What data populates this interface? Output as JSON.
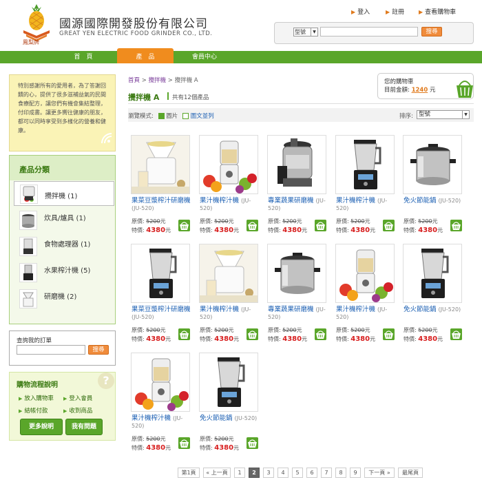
{
  "header": {
    "company_name": "國源國際開發股份有限公司",
    "company_name_en": "GREAT YEN ELECTRIC FOOD GRINDER CO., LTD.",
    "logo_text": "鳳梨牌",
    "links": [
      "登入",
      "註冊",
      "查看購物車"
    ]
  },
  "search": {
    "type_value": "型號",
    "button": "搜尋"
  },
  "nav": [
    "首　頁",
    "產　品",
    "會員中心"
  ],
  "intro": "特別感謝所有的愛用者，為了答謝回饋的心，提供了很多滋補益氣的民間食療配方，讓您們有機會集結整理，付印成書。讓更多嚮往健康的朋友，都可以同時享受到多樣化的營養和健康。",
  "categories": {
    "title": "產品分類",
    "items": [
      "攪拌機 (1)",
      "炊具/爐具 (1)",
      "食物處理器 (1)",
      "水果榨汁機 (5)",
      "研磨機 (2)"
    ]
  },
  "order_query": {
    "title": "查詢我的訂單",
    "button": "搜尋"
  },
  "flow": {
    "title": "購物流程說明",
    "links": [
      "放入購物車",
      "登入會員",
      "結帳付款",
      "收到商品"
    ],
    "buttons": [
      "更多說明",
      "我有問題"
    ]
  },
  "breadcrumb": {
    "home": "首頁",
    "sep1": ">",
    "cat": "攪拌機",
    "sep2": ">",
    "current": "攪拌機 A"
  },
  "cart": {
    "title": "您的購物車",
    "amount_label": "目前金額:",
    "amount": "1240",
    "unit": "元"
  },
  "main": {
    "category_title": "攪拌機 A",
    "count": "共有12個產品"
  },
  "view": {
    "label": "瀏覽模式:",
    "mode1": "圖片",
    "mode2": "圖文並列",
    "sort_label": "排序:",
    "sort_value": "型號"
  },
  "price_labels": {
    "orig": "原價:",
    "sale": "特價:",
    "unit": "元"
  },
  "products": [
    {
      "name": "果菜豆漿榨汁研磨機",
      "code": "(JU-520)",
      "orig": "5200",
      "price": "4380",
      "img": "grinder"
    },
    {
      "name": "果汁機榨汁機",
      "code": "(JU-520)",
      "orig": "5200",
      "price": "4380",
      "img": "blender-fruit"
    },
    {
      "name": "專業蔬果研磨機",
      "code": "(JU-520)",
      "orig": "5200",
      "price": "4380",
      "img": "juicer"
    },
    {
      "name": "果汁機榨汁機",
      "code": "(JU-520)",
      "orig": "5200",
      "price": "4380",
      "img": "blender-black"
    },
    {
      "name": "免火節能鍋",
      "code": "(JU-520)",
      "orig": "5200",
      "price": "4380",
      "img": "pot"
    },
    {
      "name": "果菜豆漿榨汁研磨機",
      "code": "(JU-520)",
      "orig": "5200",
      "price": "4380",
      "img": "blender-black"
    },
    {
      "name": "果汁機榨汁機",
      "code": "(JU-520)",
      "orig": "5200",
      "price": "4380",
      "img": "grinder"
    },
    {
      "name": "專業蔬果研磨機",
      "code": "(JU-520)",
      "orig": "5200",
      "price": "4380",
      "img": "pot"
    },
    {
      "name": "果汁機榨汁機",
      "code": "(JU-520)",
      "orig": "5200",
      "price": "4380",
      "img": "blender-fruit"
    },
    {
      "name": "免火節能鍋",
      "code": "(JU-520)",
      "orig": "5200",
      "price": "4380",
      "img": "blender-black"
    },
    {
      "name": "果汁機榨汁機",
      "code": "(JU-520)",
      "orig": "5200",
      "price": "4380",
      "img": "blender-fruit"
    },
    {
      "name": "免火節能鍋",
      "code": "(JU-520)",
      "orig": "5200",
      "price": "4380",
      "img": "blender-black"
    }
  ],
  "pagination": {
    "first": "第1頁",
    "prev": "« 上一頁",
    "pages": [
      "1",
      "2",
      "3",
      "4",
      "5",
      "6",
      "7",
      "8",
      "9"
    ],
    "current": "2",
    "next": "下一頁 »",
    "last": "最尾頁"
  },
  "colors": {
    "accent_green": "#5aa62a",
    "accent_orange": "#f08c1e",
    "price_red": "#d71d1d",
    "link_blue": "#1b5fb3"
  }
}
